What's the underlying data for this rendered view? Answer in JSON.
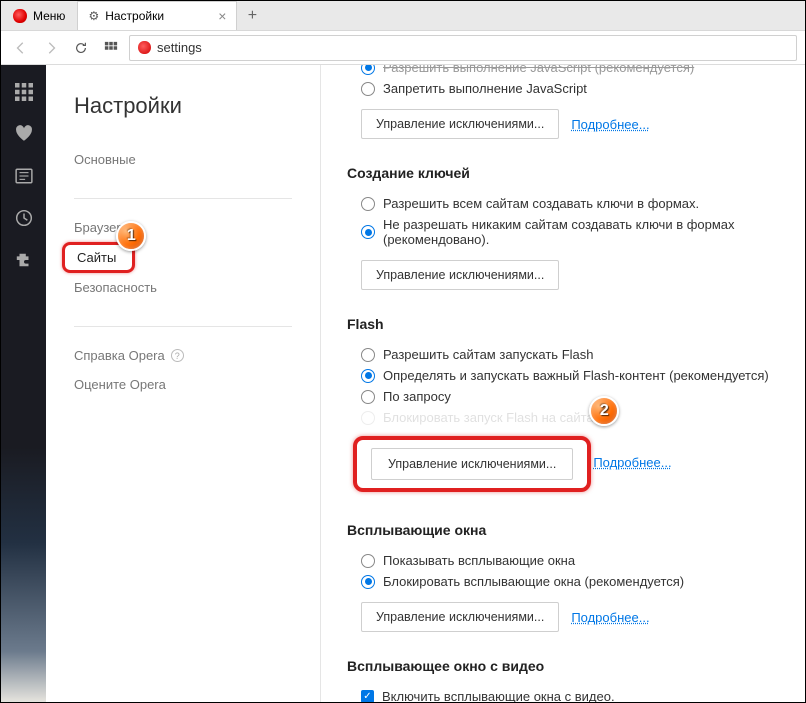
{
  "tabstrip": {
    "menu_label": "Меню",
    "active_tab_title": "Настройки"
  },
  "toolbar": {
    "address_text": "settings"
  },
  "nav": {
    "heading": "Настройки",
    "items": {
      "basic": "Основные",
      "browser": "Браузер",
      "sites": "Сайты",
      "security": "Безопасность",
      "help": "Справка Opera",
      "rate": "Оцените Opera"
    }
  },
  "content": {
    "js": {
      "allow_label": "Разрешить выполнение JavaScript (рекомендуется)",
      "deny_label": "Запретить выполнение JavaScript",
      "manage_btn": "Управление исключениями...",
      "more_link": "Подробнее..."
    },
    "keygen": {
      "heading": "Создание ключей",
      "allow_label": "Разрешить всем сайтам создавать ключи в формах.",
      "deny_label": "Не разрешать никаким сайтам создавать ключи в формах (рекомендовано).",
      "manage_btn": "Управление исключениями..."
    },
    "flash": {
      "heading": "Flash",
      "allow_label": "Разрешить сайтам запускать Flash",
      "detect_label": "Определять и запускать важный Flash-контент (рекомендуется)",
      "ondemand_label": "По запросу",
      "block_label": "Блокировать запуск Flash на сайтах",
      "manage_btn": "Управление исключениями...",
      "more_link": "Подробнее..."
    },
    "popups": {
      "heading": "Всплывающие окна",
      "show_label": "Показывать всплывающие окна",
      "block_label": "Блокировать всплывающие окна (рекомендуется)",
      "manage_btn": "Управление исключениями...",
      "more_link": "Подробнее..."
    },
    "videopop": {
      "heading": "Всплывающее окно с видео",
      "enable_label": "Включить всплывающие окна с видео."
    }
  },
  "annotations": {
    "badge1": "1",
    "badge2": "2"
  }
}
